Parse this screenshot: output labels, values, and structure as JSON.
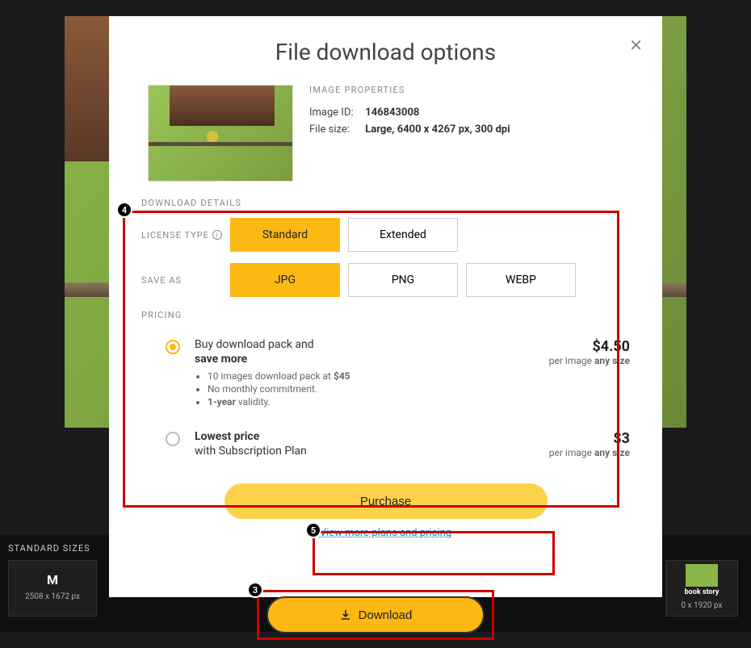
{
  "modal": {
    "title": "File download options",
    "properties_header": "IMAGE PROPERTIES",
    "image_id_lbl": "Image ID:",
    "image_id": "146843008",
    "file_size_lbl": "File size:",
    "file_size": "Large, 6400 x 4267 px, 300 dpi",
    "download_details": "DOWNLOAD DETAILS",
    "license_type_lbl": "LICENSE TYPE",
    "license": {
      "standard": "Standard",
      "extended": "Extended"
    },
    "save_as_lbl": "SAVE AS",
    "formats": {
      "jpg": "JPG",
      "png": "PNG",
      "webp": "WEBP"
    },
    "pricing_lbl": "PRICING",
    "pack": {
      "title": "Buy download pack and",
      "title2": "save more",
      "bullet1_pre": "10 images download pack at ",
      "bullet1_bold": "$45",
      "bullet2": "No monthly commitment.",
      "bullet3_bold": "1-year",
      "bullet3_post": " validity.",
      "price": "$4.50",
      "per": "per image ",
      "any": "any size"
    },
    "sub": {
      "title": "Lowest price",
      "subtitle": "with Subscription Plan",
      "price": "$3",
      "per": "per image ",
      "any": "any size"
    },
    "purchase": "Purchase",
    "plans_link": "View more plans and pricing"
  },
  "download_btn": "Download",
  "sizes": {
    "label": "STANDARD SIZES",
    "m": "M",
    "m_dim": "2508 x 1672 px",
    "story": "book story",
    "story_dim": "0 x 1920 px"
  },
  "badges": {
    "b3": "3",
    "b4": "4",
    "b5": "5"
  }
}
